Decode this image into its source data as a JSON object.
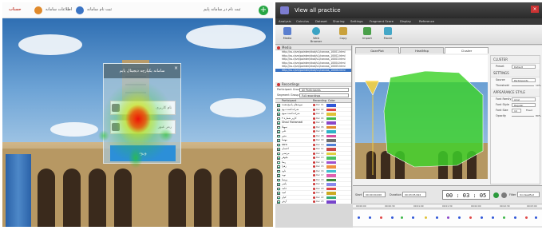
{
  "left_app": {
    "header": {
      "brand": "حساب",
      "link_profile": "اطلاعات سامانه",
      "link_register": "ثبت نام سامانه",
      "link_login": "ثبت نام در سامانه پایم"
    },
    "dialog": {
      "title": "سامانه یکپارچه دیجیتال پایم",
      "field_username": "نام کاربری",
      "field_password": "رمز عبور",
      "submit_label": "ورود"
    }
  },
  "right_app": {
    "window_title": "View all practice",
    "menu_tabs": [
      "Analysis",
      "Calculus",
      "Dataset",
      "Sharing",
      "Settings",
      "Fragment Score",
      "Display",
      "Reference"
    ],
    "ribbon": [
      {
        "label": "Media",
        "color": "#5b7fcf"
      },
      {
        "label": "Web Browser",
        "color": "#3aa3c4"
      },
      {
        "label": "Copy",
        "color": "#c9a13b"
      },
      {
        "label": "Import",
        "color": "#4aa04a"
      },
      {
        "label": "Movie",
        "color": "#44a7c7"
      }
    ],
    "media": {
      "title": "Media",
      "items": [
        "http://cs.c/sm/pointer/shot/v1/canvas_10001.html",
        "http://cs.c/sm/pointer/shot/v1/canvas_10002.html",
        "http://cs.c/sm/pointer/shot/v1/canvas_10003.html",
        "http://cs.c/sm/pointer/shot/v1/canvas_10004.html",
        "http://cs.c/sm/pointer/shot/v1/canvas_10005.html",
        "http://cs.c/sm/pointer/shot/v1/canvas_10006.html"
      ],
      "selected_index": 5
    },
    "recordings": {
      "title": "Recordings",
      "participant_group_label": "Participant Group",
      "participant_group_value": "All Participants",
      "segment_group_label": "Segment Group",
      "segment_group_value": "Full recordings",
      "col_participant": "Participant",
      "col_recording": "Recording",
      "col_color": "Color",
      "rows": [
        {
          "name": "نمونه‌های پاسخ‌دهنده",
          "rec": "Rec 01",
          "color": "#3057d8"
        },
        {
          "name": "شرکت‌کننده دوم",
          "rec": "Rec 02",
          "color": "#e04848"
        },
        {
          "name": "شرکت‌کننده سوم",
          "rec": "Rec 03",
          "color": "#e0c238"
        },
        {
          "name": "کاربر شماره ۴",
          "rec": "Rec 04",
          "color": "#3fb84a"
        },
        {
          "name": "Ghoul Mohamadi",
          "rec": "Rec 05",
          "color": "#8b46c8"
        },
        {
          "name": "سهیلا",
          "rec": "Rec 06",
          "color": "#e08a2c"
        },
        {
          "name": "علی",
          "rec": "Rec 07",
          "color": "#2fb3c8"
        },
        {
          "name": "متین",
          "rec": "Rec 08",
          "color": "#d84fa0"
        },
        {
          "name": "مهسا",
          "rec": "Rec 09",
          "color": "#6f6f6f"
        },
        {
          "name": "sara",
          "rec": "Rec 10",
          "color": "#4f7fd8"
        },
        {
          "name": "احسان",
          "rec": "Rec 11",
          "color": "#c84848"
        },
        {
          "name": "مرتضی",
          "rec": "Rec 12",
          "color": "#e0d040"
        },
        {
          "name": "نیلوفر",
          "rec": "Rec 13",
          "color": "#48c060"
        },
        {
          "name": "رضا",
          "rec": "Rec 14",
          "color": "#a050d0"
        },
        {
          "name": "زهرا",
          "rec": "Rec 15",
          "color": "#f09040"
        },
        {
          "name": "داود",
          "rec": "Rec 16",
          "color": "#40c0d0"
        },
        {
          "name": "نوید",
          "rec": "Rec 17",
          "color": "#e060b0"
        },
        {
          "name": "پریسا",
          "rec": "Rec 18",
          "color": "#3a8a3a"
        },
        {
          "name": "یاسر",
          "rec": "Rec 19",
          "color": "#8888ee"
        },
        {
          "name": "حامد",
          "rec": "Rec 20",
          "color": "#dd4444"
        },
        {
          "name": "امید",
          "rec": "Rec 21",
          "color": "#ccaa22"
        },
        {
          "name": "کیان",
          "rec": "Rec 22",
          "color": "#33aa77"
        },
        {
          "name": "آرش",
          "rec": "Rec 23",
          "color": "#7744cc"
        },
        {
          "name": "بهاره",
          "rec": "Rec 24",
          "color": "#ee7733"
        }
      ]
    },
    "viewer_tabs": [
      "GazePlot",
      "HeatMap",
      "Cluster"
    ],
    "viewer_active_tab": 2,
    "settings_panel": {
      "heading_cluster": "CLUSTER",
      "preset_label": "Preset",
      "preset_value": "Default",
      "heading_settings": "SETTINGS",
      "source_label": "Source",
      "source_value": "Participants",
      "threshold_label": "Threshold",
      "threshold_value": "10%",
      "heading_appearance": "APPEARANCE STYLE",
      "font_family_label": "Font Family",
      "font_family_value": "Arial",
      "font_style_label": "Font Style",
      "font_style_value": "Regular",
      "font_size_label": "Font Size",
      "font_size_value": "10",
      "fixed_label": "Fixed",
      "opacity_label": "Opacity",
      "opacity_value": "80%"
    },
    "timeline": {
      "start_label": "Start",
      "start_value": "00:00:00.000",
      "duration_label": "Duration",
      "duration_value": "00:03:05.994",
      "timer_value": "00 : 03 : 05",
      "timer_ms": "994",
      "filter_label": "Filter",
      "filter_value": "Unclassified",
      "ticks": [
        "00:00:00",
        "00:00:30",
        "00:01:00",
        "00:01:30",
        "00:02:00",
        "00:02:30",
        "00:03:00"
      ]
    }
  }
}
